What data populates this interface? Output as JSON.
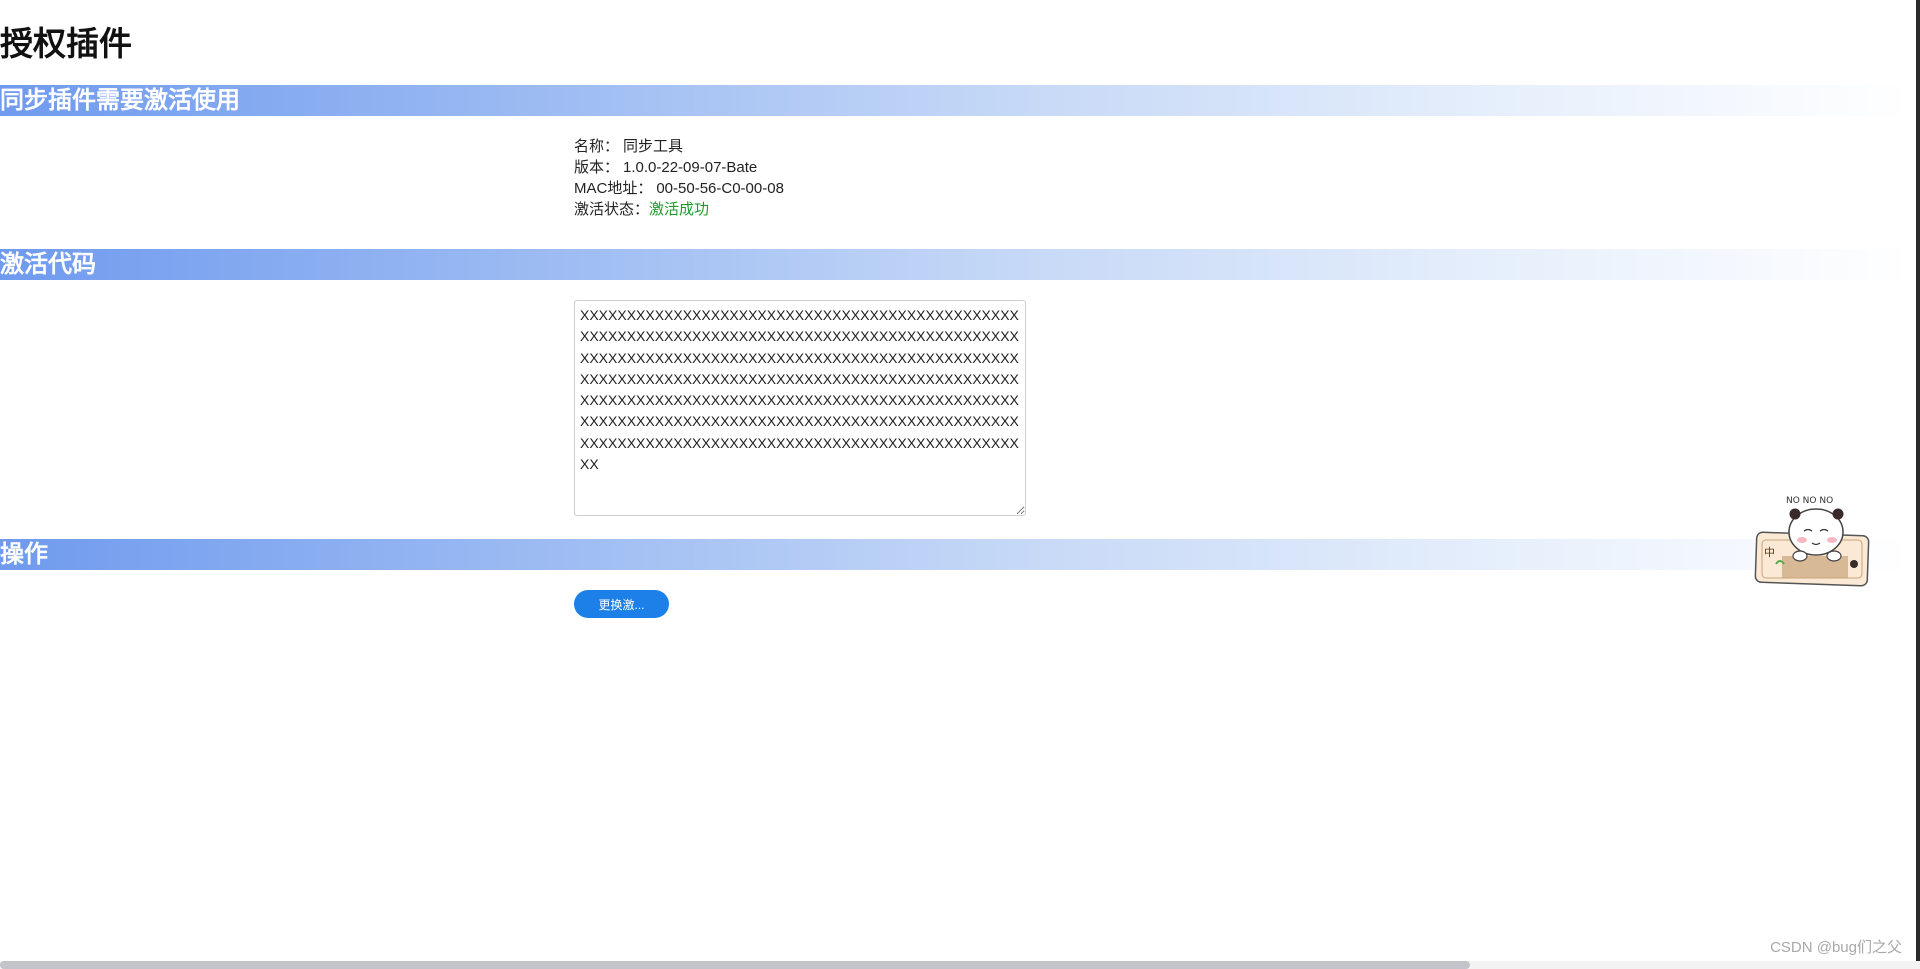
{
  "page": {
    "title": "授权插件"
  },
  "sections": {
    "sync": {
      "title": "同步插件需要激活使用"
    },
    "code": {
      "title": "激活代码"
    },
    "ops": {
      "title": "操作"
    }
  },
  "info": {
    "name_label": "名称：",
    "name_value": "同步工具",
    "version_label": "版本：",
    "version_value": "1.0.0-22-09-07-Bate",
    "mac_label": "MAC地址：",
    "mac_value": "00-50-56-C0-00-08",
    "status_label": "激活状态：",
    "status_value": "激活成功"
  },
  "activation": {
    "code": "XXXXXXXXXXXXXXXXXXXXXXXXXXXXXXXXXXXXXXXXXXXXXXXXXXXXXXXXXXXXXXXXXXXXXXXXXXXXXXXXXXXXXXXXXXXXXXXXXXXXXXXXXXXXXXXXXXXXXXXXXXXXXXXXXXXXXXXXXXXXXXXXXXXXXXXXXXXXXXXXXXXXXXXXXXXXXXXXXXXXXXXXXXXXXXXXXXXXXXXXXXXXXXXXXXXXXXXXXXXXXXXXXXXXXXXXXXXXXXXXXXXXXXXXXXXXXXXXXXXXXXXXXXXXXXXXXXXXXXXXXXXXXXXXXXXXXXXXXXXXXXXXXXXXXXXXXXXXXXXXXXXXXXXXXXX"
  },
  "actions": {
    "change_label": "更换激..."
  },
  "mascot": {
    "caption": "NO NO NO",
    "badge": "中"
  },
  "watermark": "CSDN @bug们之父",
  "colors": {
    "section_gradient_start": "#6f9aee",
    "button": "#1d80e8",
    "status_ok": "#1b9a2a"
  }
}
